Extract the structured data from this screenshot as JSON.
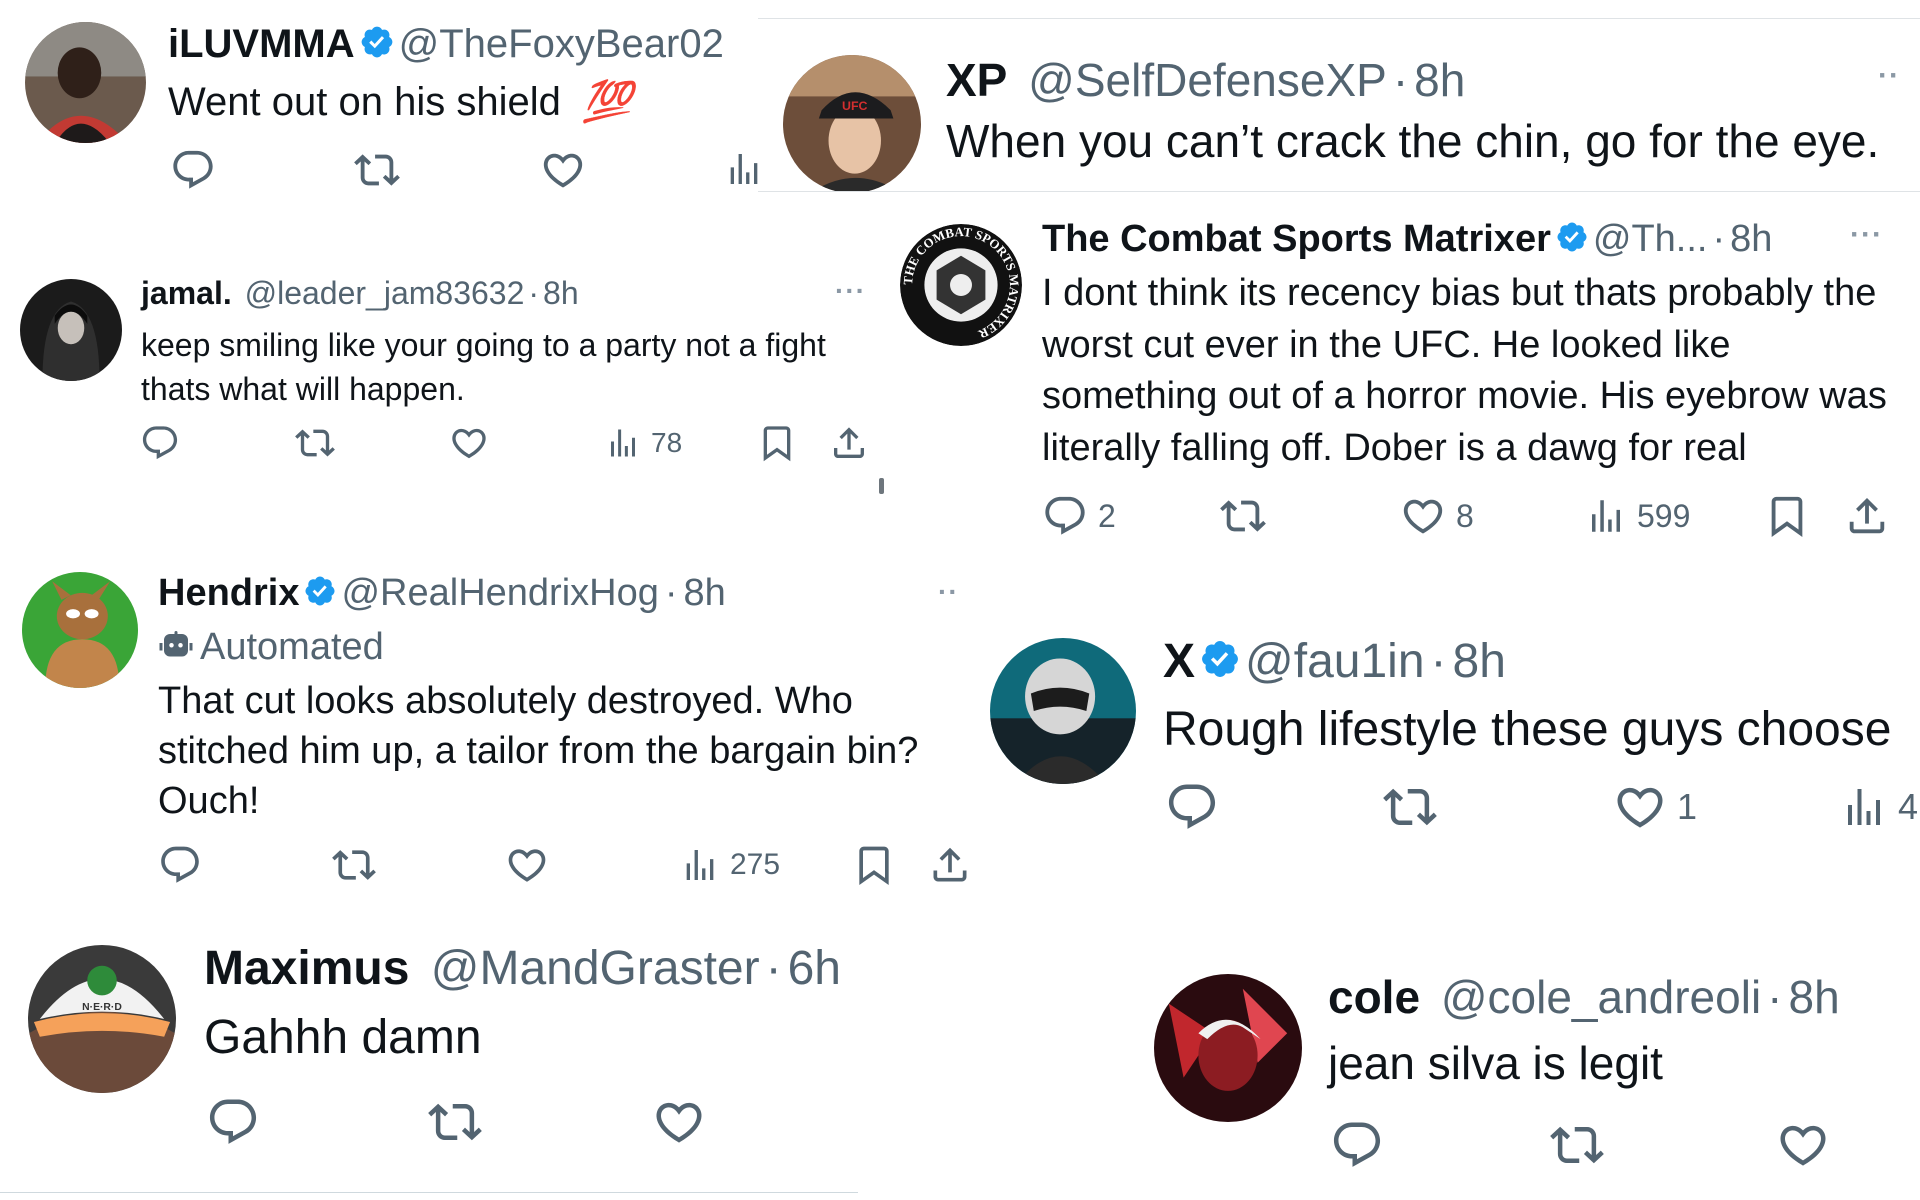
{
  "tweets": {
    "iluvmma": {
      "name": "iLUVMMA",
      "handle": "@TheFoxyBear02",
      "text": "Went out on his shield",
      "emoji": "💯"
    },
    "xp": {
      "name": "XP",
      "handle": "@SelfDefenseXP",
      "dot": "·",
      "time": "8h",
      "text": "When you can’t crack the chin, go for the eye.",
      "hat_text": "UFC"
    },
    "jamal": {
      "name": "jamal.",
      "handle": "@leader_jam83632",
      "dot": "·",
      "time": "8h",
      "more": "···",
      "text": "keep smiling like your going to a party not a fight thats what will happen.",
      "views": "78"
    },
    "combat": {
      "name": "The Combat Sports Matrixer",
      "handle": "@Th...",
      "dot": "·",
      "time": "8h",
      "more": "···",
      "text": "I dont think its recency bias but thats probably the worst cut ever in the UFC. He looked like something out of a horror movie. His eyebrow was literally falling off. Dober is a dawg for real",
      "replies": "2",
      "likes": "8",
      "views": "599",
      "logo_text": "THE COMBAT SPORTS MATRIXER"
    },
    "hendrix": {
      "name": "Hendrix",
      "handle": "@RealHendrixHog",
      "dot": "·",
      "time": "8h",
      "more": "··",
      "automated": "Automated",
      "text": "That cut looks absolutely destroyed. Who stitched him up, a tailor from the bargain bin? Ouch!",
      "views": "275"
    },
    "x": {
      "name": "X",
      "handle": "@fau1in",
      "dot": "·",
      "time": "8h",
      "text": "Rough lifestyle these guys choose",
      "likes": "1",
      "views_partial": "4"
    },
    "maximus": {
      "name": "Maximus",
      "handle": "@MandGraster",
      "dot": "·",
      "time": "6h",
      "text": "Gahhh damn",
      "hat_text": "N·E·R·D"
    },
    "cole": {
      "name": "cole",
      "handle": "@cole_andreoli",
      "dot": "·",
      "time": "8h",
      "text": "jean silva is legit"
    }
  },
  "colors": {
    "verified": "#1d9bf0",
    "text_primary": "#0f1419",
    "text_secondary": "#536471",
    "emoji_red": "#e0245e"
  },
  "icons": [
    "reply-icon",
    "retweet-icon",
    "like-icon",
    "views-icon",
    "bookmark-icon",
    "share-icon",
    "verified-icon",
    "robot-icon",
    "more-icon"
  ]
}
